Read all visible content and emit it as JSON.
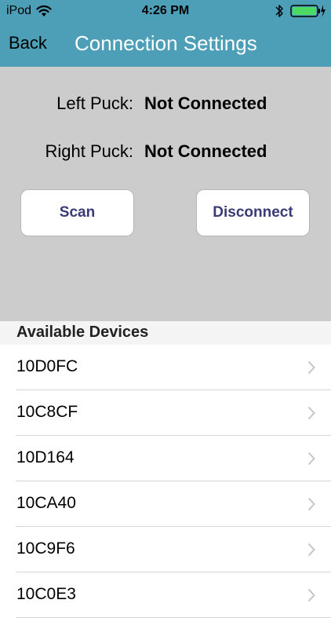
{
  "status_bar": {
    "carrier": "iPod",
    "time": "4:26 PM"
  },
  "nav": {
    "back_label": "Back",
    "title": "Connection Settings"
  },
  "connection": {
    "left_label": "Left Puck:",
    "left_value": "Not Connected",
    "right_label": "Right Puck:",
    "right_value": "Not Connected"
  },
  "buttons": {
    "scan_label": "Scan",
    "disconnect_label": "Disconnect"
  },
  "devices": {
    "header": "Available Devices",
    "items": [
      "10D0FC",
      "10C8CF",
      "10D164",
      "10CA40",
      "10C9F6",
      "10C0E3"
    ]
  },
  "colors": {
    "nav_bar": "#4c9fb6",
    "panel": "#cccccc",
    "button_text": "#3b3b78",
    "battery": "#4cd964"
  },
  "icons": {
    "wifi": "wifi-icon",
    "bluetooth": "bluetooth-icon",
    "battery": "battery-charging-icon",
    "chevron": "chevron-right-icon"
  }
}
